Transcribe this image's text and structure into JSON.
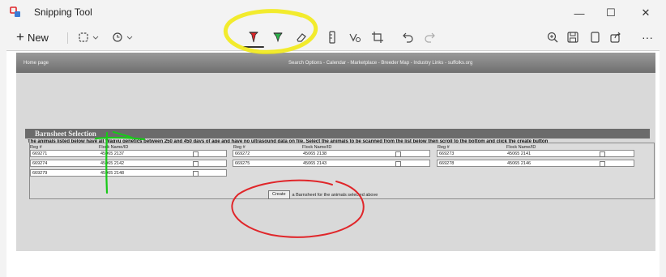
{
  "window": {
    "app_title": "Snipping Tool",
    "minimize": "—",
    "maximize": "☐",
    "close": "✕"
  },
  "toolbar": {
    "new_label": "New",
    "more": "···"
  },
  "webpage": {
    "home_link": "Home page",
    "nav_text": "Search Options - Calendar - Marketplace - Breeder Map - Industry Links - suffolks.org",
    "section_title": "Barnsheet Selection",
    "instructions": "The animals listed below have all Wagyu genetics between 250 and 450 days of age and have no ultrasound data on file. Select the animals to be scanned from the list below then scroll to the bottom and click the create button",
    "columns": [
      "Reg #",
      "Flock Name/ID"
    ],
    "animal_groups": [
      [
        {
          "reg": "669271",
          "flock": "45065 2137"
        },
        {
          "reg": "669274",
          "flock": "45065 2142"
        },
        {
          "reg": "669279",
          "flock": "45065 2148"
        }
      ],
      [
        {
          "reg": "669272",
          "flock": "45065 2138"
        },
        {
          "reg": "669275",
          "flock": "45065 2143"
        }
      ],
      [
        {
          "reg": "669273",
          "flock": "45065 2141"
        },
        {
          "reg": "669278",
          "flock": "45065 2146"
        }
      ]
    ],
    "create_button": "Create",
    "create_suffix": "a Barnsheet for the animals selected above"
  },
  "annotations": {
    "yellow": "#f2ea17",
    "green": "#18c918",
    "red": "#e0262a"
  }
}
